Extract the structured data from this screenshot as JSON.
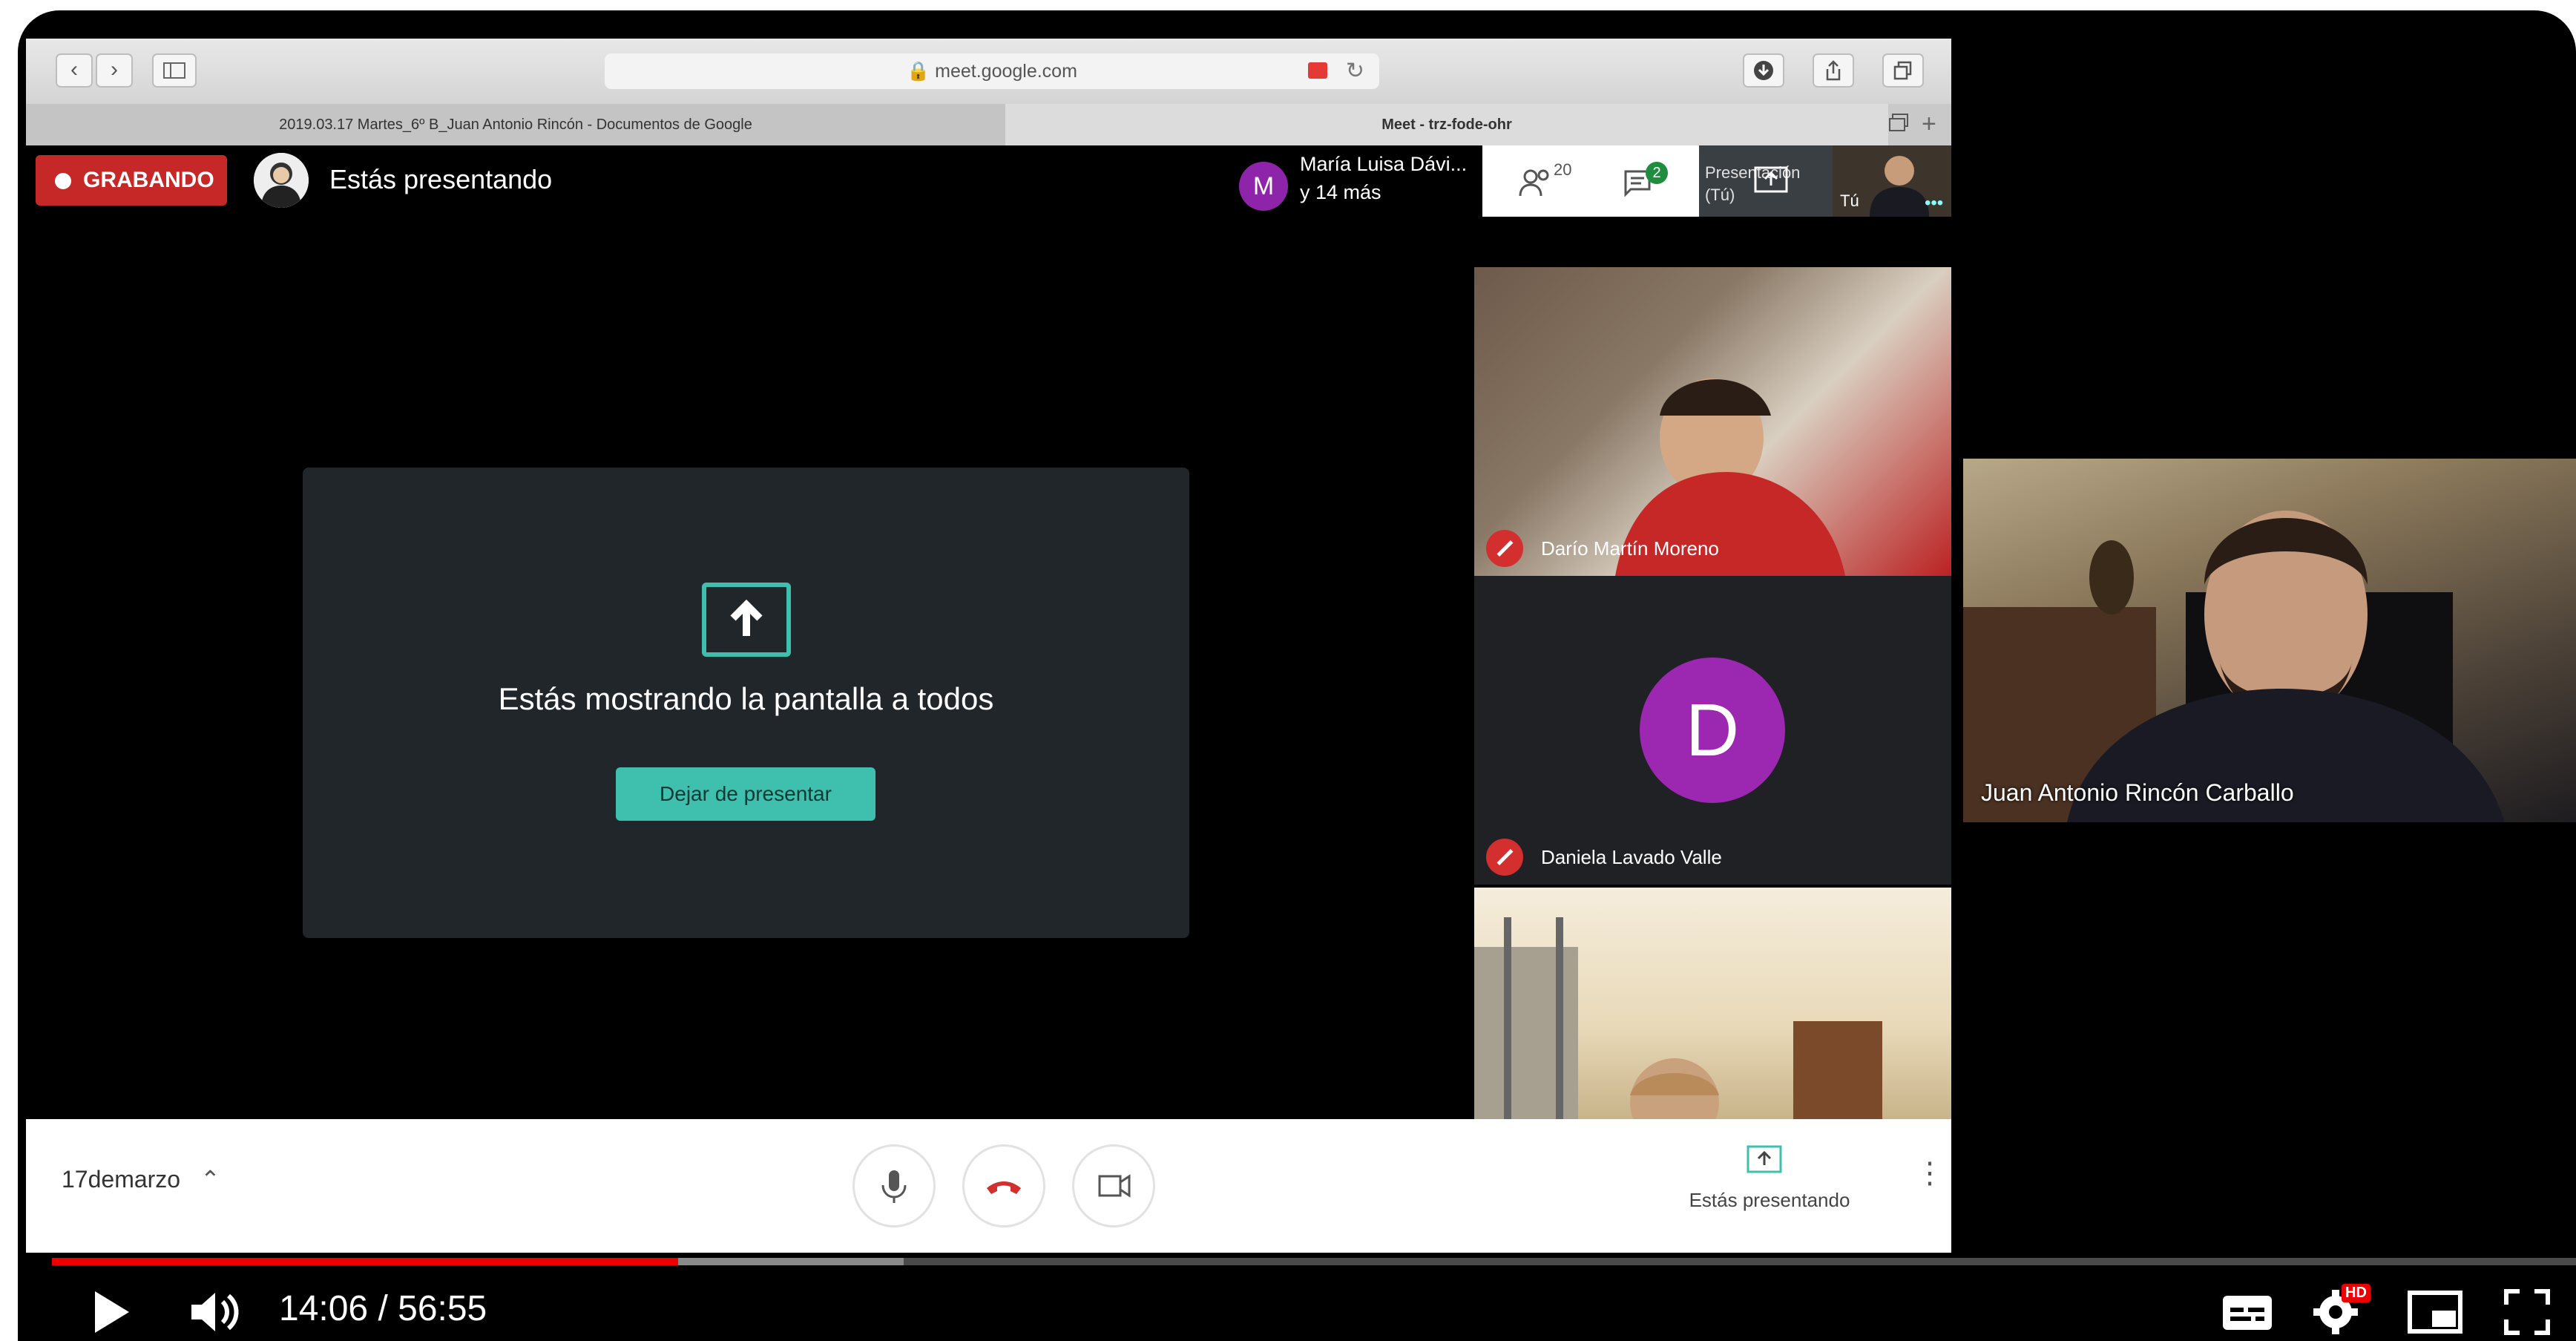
{
  "browser": {
    "url": "meet.google.com",
    "tabs": [
      "2019.03.17 Martes_6º B_Juan Antonio Rincón - Documentos de Google",
      "Meet - trz-fode-ohr"
    ],
    "back_glyph": "‹",
    "forward_glyph": "›"
  },
  "meet": {
    "recording_label": "GRABANDO",
    "presenting_label": "Estás presentando",
    "participants_summary": {
      "avatar_letter": "M",
      "name": "María Luisa Dávi...",
      "more": "y 14 más"
    },
    "people_count": "20",
    "chat_badge": "2",
    "presentation_tile_label": "Presentación (Tú)",
    "self_tile_label": "Tú",
    "card": {
      "message": "Estás mostrando la pantalla a todos",
      "stop_button": "Dejar de presentar"
    },
    "tiles": [
      {
        "name": "Darío Martín Moreno",
        "muted": true
      },
      {
        "name": "Daniela Lavado Valle",
        "avatar_letter": "D",
        "avatar_color": "#9c27b0",
        "muted": true
      },
      {
        "name": ""
      }
    ],
    "bottom": {
      "meeting_name": "17demarzo",
      "presenting_label": "Estás presentando"
    }
  },
  "camera_overlay": {
    "name": "Juan Antonio Rincón Carballo"
  },
  "youtube": {
    "time_current": "14:06",
    "time_total": "56:55",
    "time_display": "14:06 / 56:55",
    "progress_fraction": 0.248,
    "buffered_fraction": 0.3375,
    "quality_badge": "HD"
  },
  "colors": {
    "recording": "#c62828",
    "meet_accent": "#3fbfae",
    "progress": "#ee0000",
    "avatar_M": "#8e24aa"
  }
}
